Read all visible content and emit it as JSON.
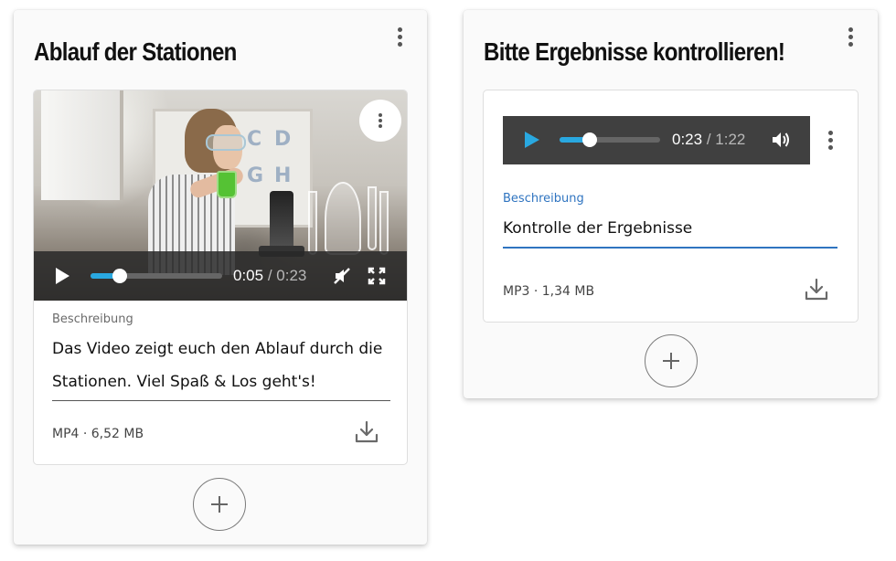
{
  "cards": [
    {
      "title": "Ablauf der Stationen",
      "player": {
        "current_time": "0:05",
        "separator": " / ",
        "duration": "0:23",
        "progress": 0.22
      },
      "description_label": "Beschreibung",
      "description_value": "Das Video zeigt euch den Ablauf durch die Stationen. Viel Spaß & Los geht's!",
      "file_meta": "MP4 · 6,52 MB",
      "board_letters": [
        "C",
        "D",
        "G",
        "H"
      ]
    },
    {
      "title": "Bitte Ergebnisse kontrollieren!",
      "player": {
        "current_time": "0:23",
        "separator": " / ",
        "duration": "1:22",
        "progress": 0.3
      },
      "description_label": "Beschreibung",
      "description_value": "Kontrolle der Ergebnisse",
      "file_meta": "MP3 · 1,34 MB"
    }
  ],
  "colors": {
    "accent": "#29a8e0",
    "label_active": "#2f74c0",
    "field_underline_active": "#2f74c0",
    "player_bg": "#404040"
  },
  "icons": [
    "kebab-icon",
    "play-icon",
    "mute-icon",
    "fullscreen-icon",
    "volume-icon",
    "download-icon",
    "plus-icon"
  ]
}
